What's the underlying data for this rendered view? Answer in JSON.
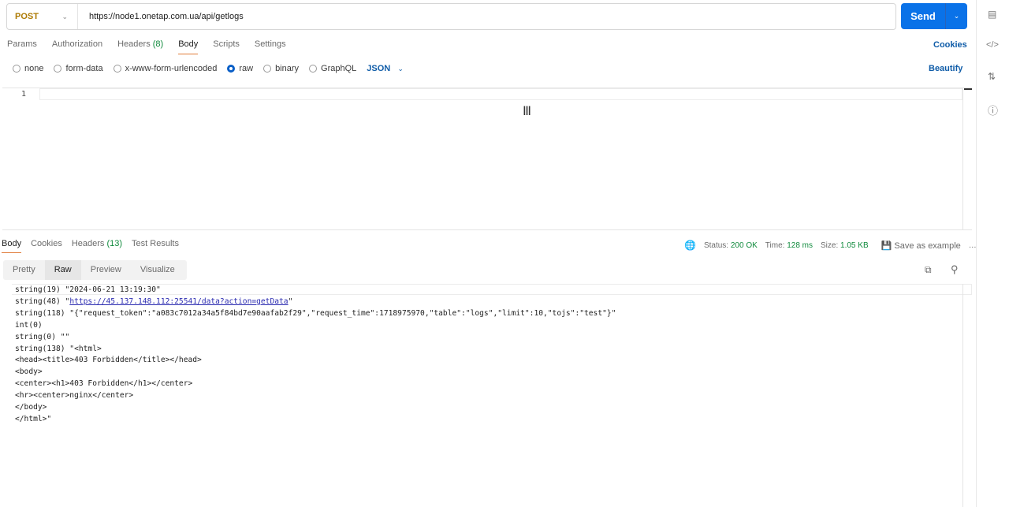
{
  "request": {
    "method": "POST",
    "url": "https://node1.onetap.com.ua/api/getlogs",
    "send_label": "Send"
  },
  "req_tabs": {
    "params": "Params",
    "authorization": "Authorization",
    "headers": "Headers",
    "headers_count": "(8)",
    "body": "Body",
    "scripts": "Scripts",
    "settings": "Settings",
    "cookies": "Cookies"
  },
  "body_types": {
    "none": "none",
    "form_data": "form-data",
    "urlencoded": "x-www-form-urlencoded",
    "raw": "raw",
    "binary": "binary",
    "graphql": "GraphQL",
    "format": "JSON",
    "beautify": "Beautify"
  },
  "editor": {
    "line_number": "1"
  },
  "resp_tabs": {
    "body": "Body",
    "cookies": "Cookies",
    "headers": "Headers",
    "headers_count": "(13)",
    "tests": "Test Results"
  },
  "resp_meta": {
    "status_label": "Status:",
    "status": "200 OK",
    "time_label": "Time:",
    "time": "128 ms",
    "size_label": "Size:",
    "size": "1.05 KB",
    "save": "Save as example"
  },
  "view_tabs": {
    "pretty": "Pretty",
    "raw": "Raw",
    "preview": "Preview",
    "visualize": "Visualize"
  },
  "response_lines": {
    "l0": "string(19) \"2024-06-21 13:19:30\"",
    "l1_prefix": "string(48) \"",
    "l1_link": "https://45.137.148.112:25541/data?action=getData",
    "l1_suffix": "\"",
    "l2": "string(118) \"{\"request_token\":\"a083c7012a34a5f84bd7e90aafab2f29\",\"request_time\":1718975970,\"table\":\"logs\",\"limit\":10,\"tojs\":\"test\"}\"",
    "l3": "int(0)",
    "l4": "string(0) \"\"",
    "l5": "string(138) \"<html>",
    "l6": "<head><title>403 Forbidden</title></head>",
    "l7": "<body>",
    "l8": "<center><h1>403 Forbidden</h1></center>",
    "l9": "<hr><center>nginx</center>",
    "l10": "</body>",
    "l11": "</html>\""
  }
}
